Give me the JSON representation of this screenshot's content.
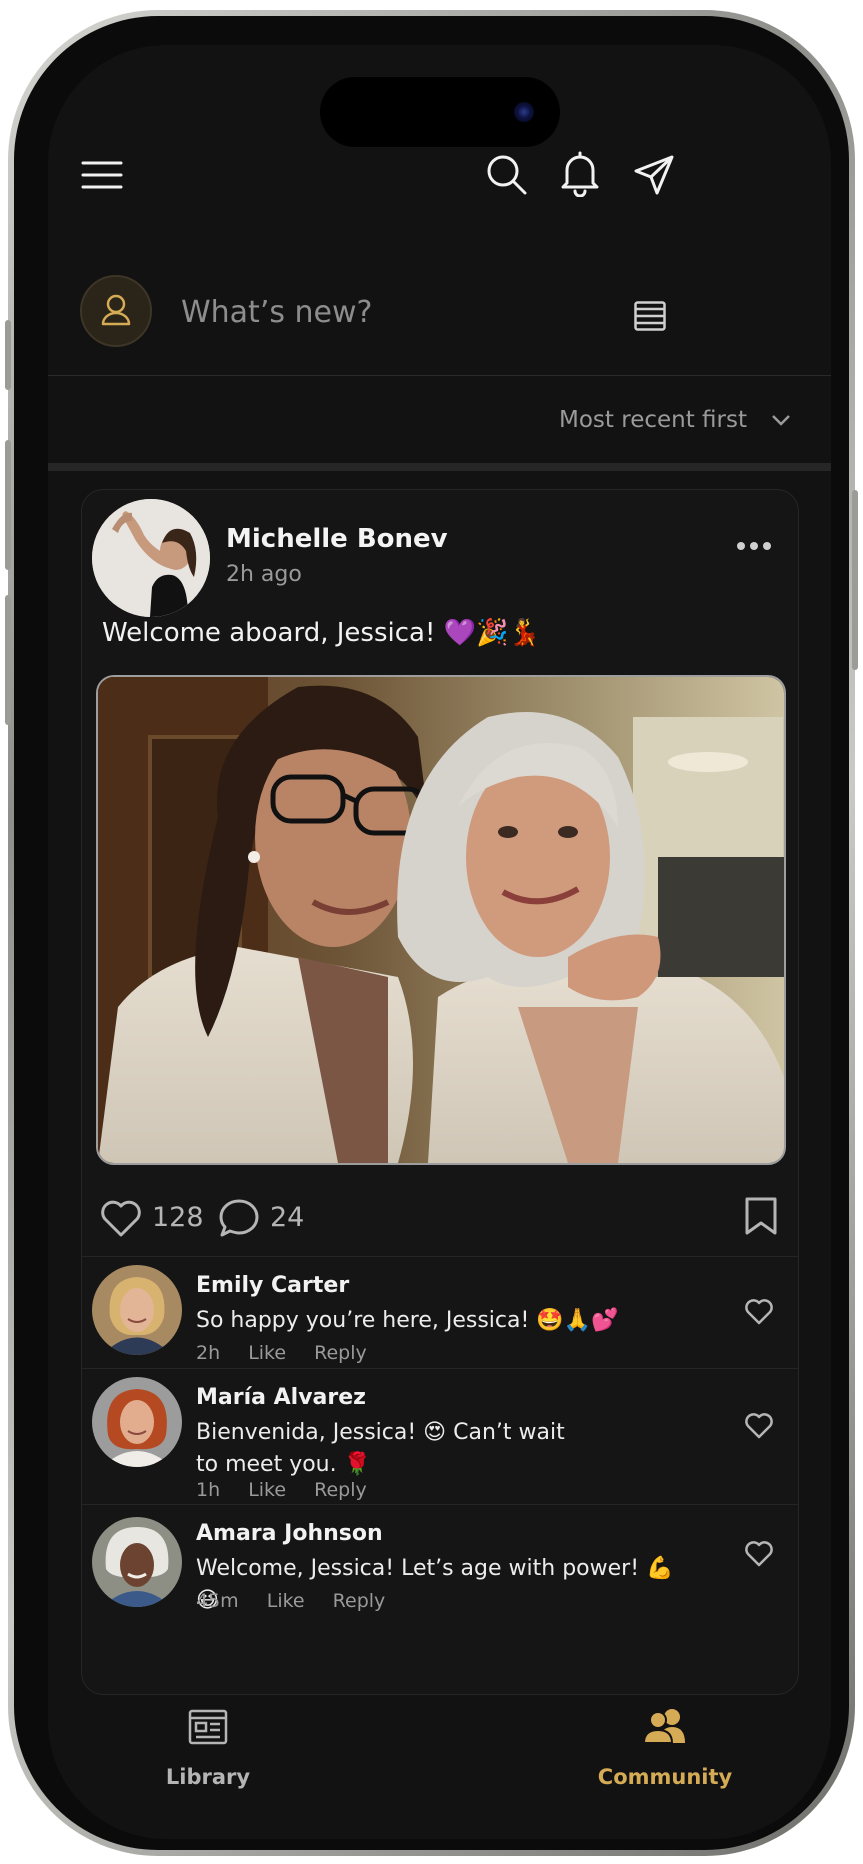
{
  "header": {
    "menu_icon": "hamburger-menu-icon",
    "search_icon": "search-icon",
    "notifications_icon": "bell-icon",
    "messages_icon": "paper-plane-icon"
  },
  "composer": {
    "placeholder": "What’s new?",
    "avatar_icon": "user-icon",
    "format_icon": "lines-icon"
  },
  "sort": {
    "selected": "Most recent first"
  },
  "post": {
    "author": "Michelle Bonev",
    "time": "2h ago",
    "text": "Welcome aboard, Jessica! 💜🎉💃",
    "likes": "128",
    "comments": "24",
    "comments_list": [
      {
        "name": "Emily Carter",
        "text": "So happy you’re here, Jessica! 🤩🙏💕",
        "time": "2h",
        "like": "Like",
        "reply": "Reply"
      },
      {
        "name": "María Alvarez",
        "text": "Bienvenida, Jessica! 😍 Can’t wait to meet you. 🌹",
        "time": "1h",
        "like": "Like",
        "reply": "Reply"
      },
      {
        "name": "Amara Johnson",
        "text": "Welcome, Jessica! Let’s age with power! 💪😆",
        "time": "45m",
        "like": "Like",
        "reply": "Reply"
      }
    ]
  },
  "tabs": [
    {
      "label": "Library",
      "icon": "newspaper-icon",
      "active": false
    },
    {
      "label": "Community",
      "icon": "users-icon",
      "active": true
    }
  ],
  "colors": {
    "accent": "#d6ab55",
    "background": "#121212",
    "card": "#151515",
    "muted_text": "#9a9a9a"
  }
}
